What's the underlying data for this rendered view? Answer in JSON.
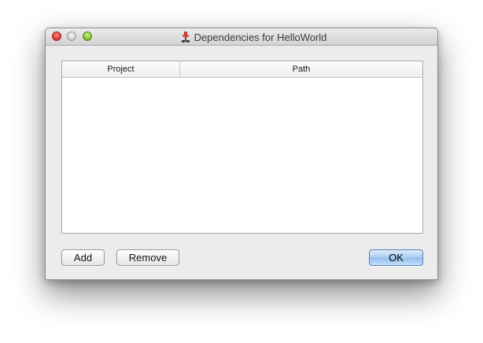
{
  "window": {
    "title": "Dependencies for HelloWorld",
    "app_icon": "xcode-hammer-icon"
  },
  "table": {
    "columns": [
      "Project",
      "Path"
    ],
    "rows": []
  },
  "buttons": {
    "add_label": "Add",
    "remove_label": "Remove",
    "ok_label": "OK"
  },
  "colors": {
    "default_button_accent": "#8fbdec",
    "close_button": "#e0443b",
    "zoom_button": "#8cc43a"
  }
}
